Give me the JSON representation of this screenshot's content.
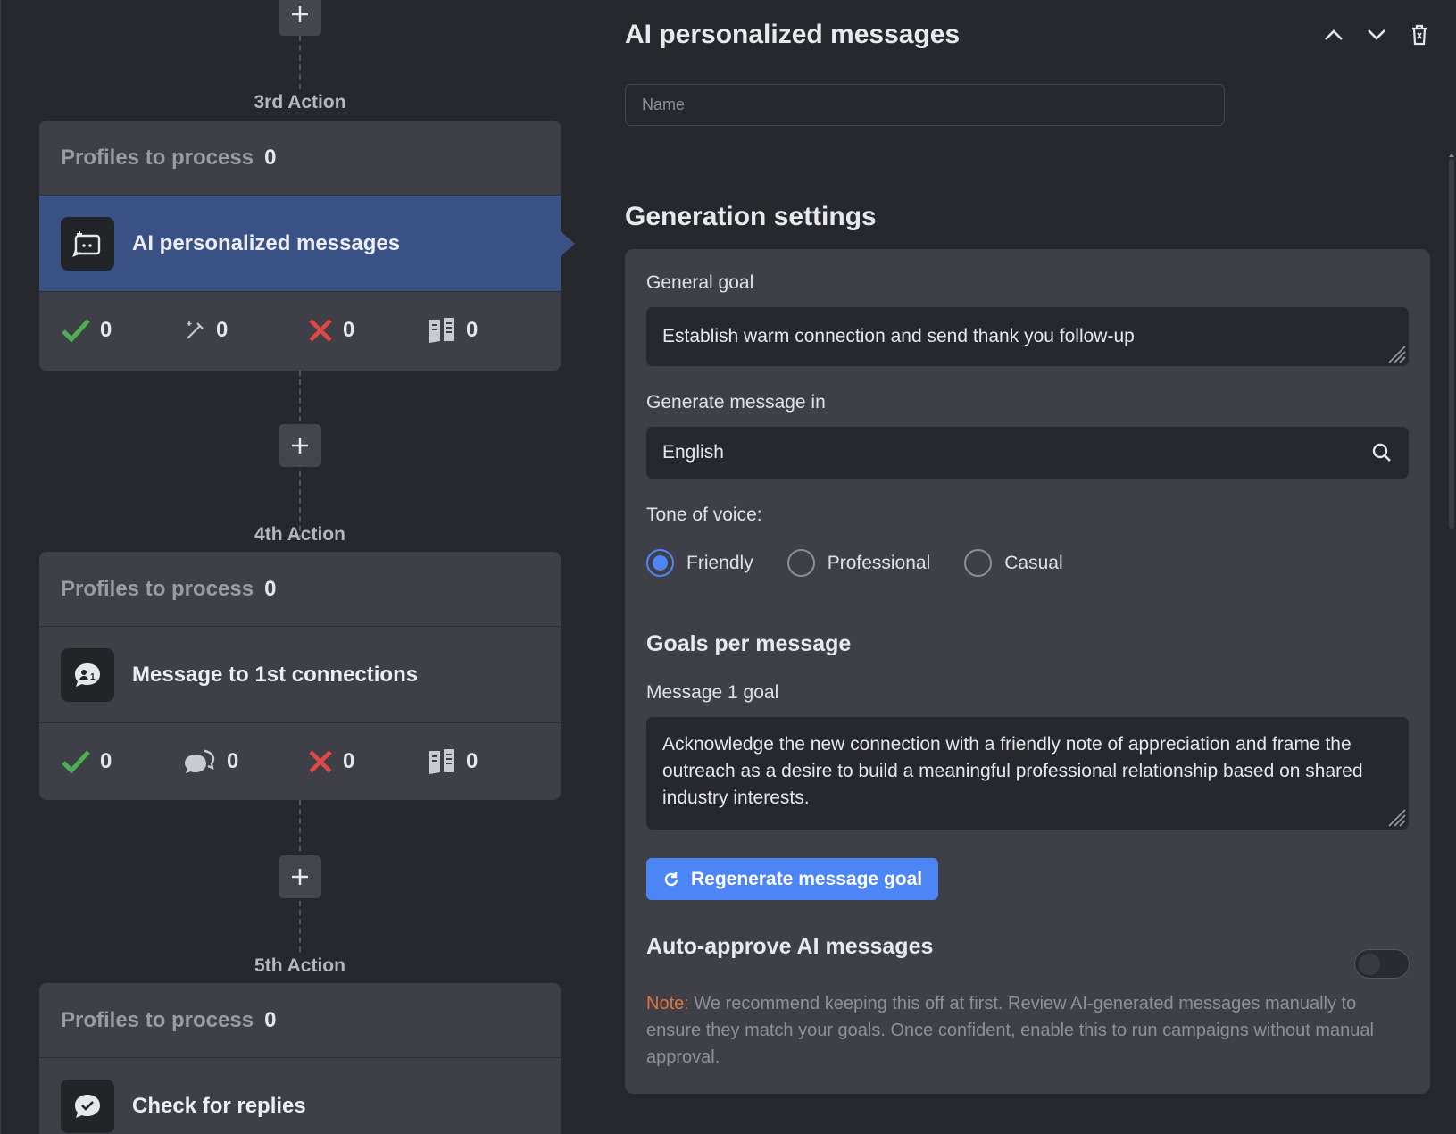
{
  "left": {
    "actions": [
      {
        "label": "3rd Action",
        "profiles_label": "Profiles to process",
        "profiles_count": "0",
        "title": "AI personalized messages",
        "stats": [
          "0",
          "0",
          "0",
          "0"
        ]
      },
      {
        "label": "4th Action",
        "profiles_label": "Profiles to process",
        "profiles_count": "0",
        "title": "Message to 1st connections",
        "stats": [
          "0",
          "0",
          "0",
          "0"
        ]
      },
      {
        "label": "5th Action",
        "profiles_label": "Profiles to process",
        "profiles_count": "0",
        "title": "Check for replies"
      }
    ]
  },
  "right": {
    "title": "AI personalized messages",
    "name_placeholder": "Name",
    "section_title": "Generation settings",
    "general_goal_label": "General goal",
    "general_goal_value": "Establish warm connection and send thank you follow-up",
    "language_label": "Generate message in",
    "language_value": "English",
    "tone_label": "Tone of voice:",
    "tones": [
      "Friendly",
      "Professional",
      "Casual"
    ],
    "selected_tone": "Friendly",
    "goals_title": "Goals per message",
    "message1_label": "Message 1 goal",
    "message1_value": "Acknowledge the new connection with a friendly note of appreciation and frame the outreach as a desire to build a meaningful professional relationship based on shared industry interests.",
    "regen_label": "Regenerate message goal",
    "auto_approve_title": "Auto-approve AI messages",
    "auto_approve_on": false,
    "note_tag": "Note:",
    "note_text": " We recommend keeping this off at first. Review AI-generated messages manually to ensure they match your goals. Once confident, enable this to run campaigns without manual approval."
  },
  "colors": {
    "accent": "#4c86f6",
    "active_card": "#3a5186",
    "success": "#4caf50",
    "danger": "#e04848",
    "note": "#e0743a"
  }
}
